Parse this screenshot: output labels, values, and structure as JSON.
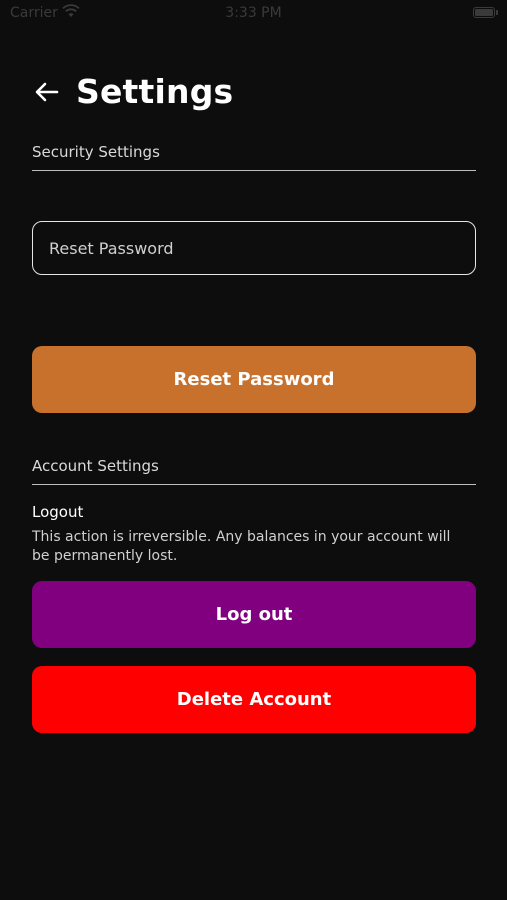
{
  "status_bar": {
    "carrier": "Carrier",
    "time": "3:33 PM"
  },
  "header": {
    "back_icon": "arrow-left-icon",
    "title": "Settings"
  },
  "security": {
    "section_label": "Security Settings",
    "input_placeholder": "Reset Password",
    "input_value": "",
    "button_label": "Reset Password",
    "button_color": "#c8712d"
  },
  "account": {
    "section_label": "Account Settings",
    "logout_title": "Logout",
    "logout_description": "This action is irreversible. Any balances in your account will be permanently lost.",
    "logout_button_label": "Log out",
    "logout_button_color": "#800080",
    "delete_button_label": "Delete Account",
    "delete_button_color": "#ff0000"
  }
}
